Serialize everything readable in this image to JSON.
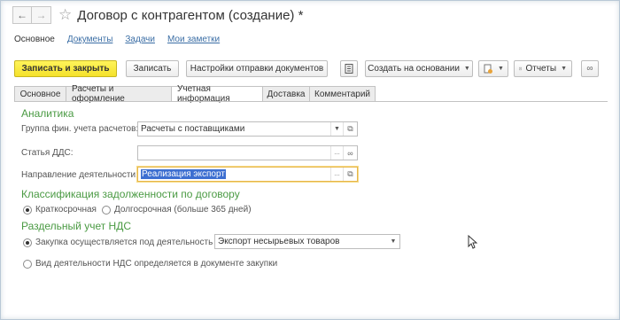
{
  "window": {
    "title": "Договор с контрагентом (создание) *"
  },
  "nav_links": [
    {
      "label": "Основное"
    },
    {
      "label": "Документы"
    },
    {
      "label": "Задачи"
    },
    {
      "label": "Мои заметки"
    }
  ],
  "toolbar": {
    "save_close_label": "Записать и закрыть",
    "save_label": "Записать",
    "send_settings_label": "Настройки отправки документов",
    "create_based_label": "Создать на основании",
    "reports_label": "Отчеты"
  },
  "tabs": [
    {
      "label": "Основное"
    },
    {
      "label": "Расчеты и оформление"
    },
    {
      "label": "Учетная информация"
    },
    {
      "label": "Доставка"
    },
    {
      "label": "Комментарий"
    }
  ],
  "analytics": {
    "heading": "Аналитика",
    "fin_group_label": "Группа фин. учета расчетов:",
    "fin_group_value": "Расчеты с поставщиками",
    "dds_label": "Статья ДДС:",
    "dds_value": "",
    "direction_label": "Направление деятельности:",
    "direction_value": "Реализация экспорт"
  },
  "debt_classification": {
    "heading": "Классификация задолженности по договору",
    "short_label": "Краткосрочная",
    "long_label": "Долгосрочная (больше 365 дней)",
    "selected": "short"
  },
  "vat": {
    "heading": "Раздельный учет НДС",
    "purchase_label": "Закупка осуществляется под деятельность",
    "purchase_value": "Экспорт несырьевых товаров",
    "doc_label": "Вид деятельности НДС определяется в документе закупки",
    "selected": "purchase"
  }
}
